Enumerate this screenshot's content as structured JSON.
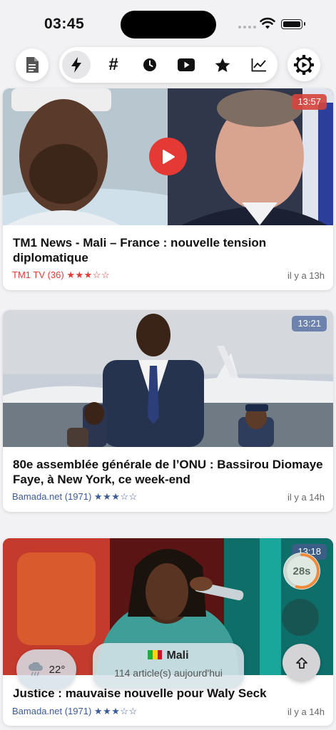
{
  "status_bar": {
    "time": "03:45"
  },
  "toolbar": {
    "left_icon": "document-icon",
    "tabs": [
      {
        "name": "lightning-icon",
        "active": true
      },
      {
        "name": "hash-icon",
        "label": "#"
      },
      {
        "name": "clock-icon"
      },
      {
        "name": "youtube-icon"
      },
      {
        "name": "star-icon"
      },
      {
        "name": "chart-icon"
      }
    ],
    "right_icon": "gear-icon"
  },
  "articles": [
    {
      "duration": "13:57",
      "title": "TM1 News - Mali – France : nouvelle tension diplomatique",
      "source": "TM1 TV (36)",
      "rating": 3,
      "stars": "★★★☆☆",
      "time_ago": "il y a 13h",
      "accent": "#e53935",
      "is_video": true
    },
    {
      "duration": "13:21",
      "title": "80e assemblée générale de l’ONU : Bassirou Diomaye Faye, à New York, ce week-end",
      "source": "Bamada.net (1971)",
      "rating": 3,
      "stars": "★★★☆☆",
      "time_ago": "il y a 14h",
      "accent": "#3b5a9a"
    },
    {
      "duration": "13:18",
      "title": "Justice : mauvaise nouvelle pour Waly Seck",
      "source": "Bamada.net (1971)",
      "rating": 3,
      "stars": "★★★☆☆",
      "time_ago": "il y a 14h",
      "accent": "#3b5a9a"
    }
  ],
  "weather": {
    "temperature": "22°",
    "icon": "cloud-rain-icon"
  },
  "country": {
    "name": "Mali",
    "articles_today": "114 article(s) aujourd'hui",
    "flag_colors": [
      "#14b53a",
      "#fcd116",
      "#ce1126"
    ]
  },
  "refresh_timer": {
    "label": "28s",
    "progress": 0.55
  },
  "scroll_top_icon": "arrow-up-icon"
}
